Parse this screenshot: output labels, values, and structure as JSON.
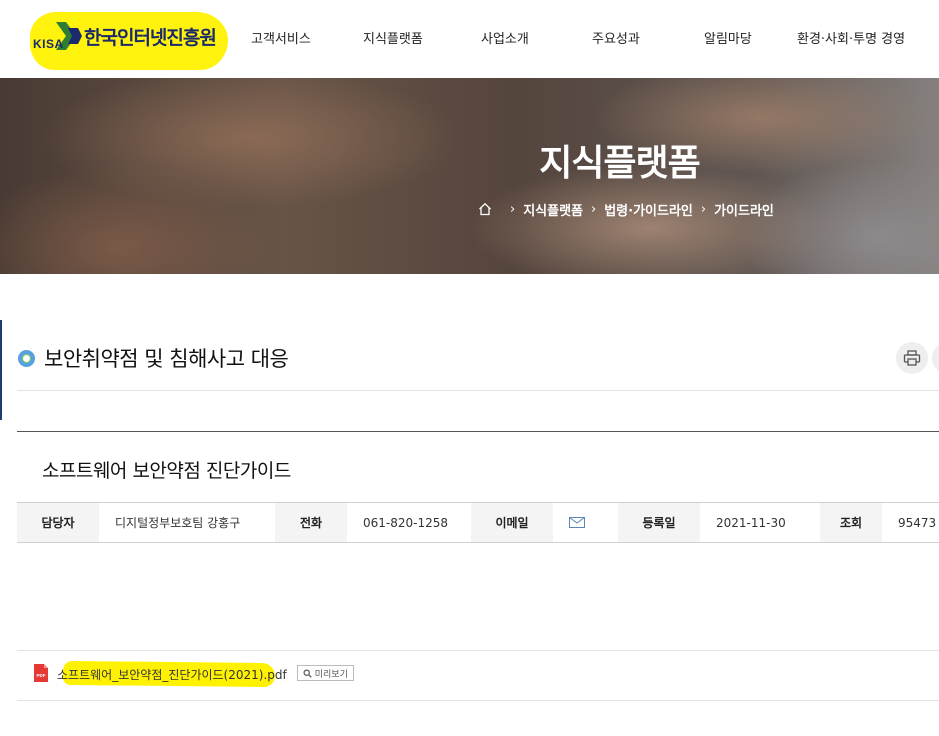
{
  "header": {
    "logo_abbr": "KISA",
    "logo_name": "한국인터넷진흥원",
    "nav": [
      "고객서비스",
      "지식플랫폼",
      "사업소개",
      "주요성과",
      "알림마당",
      "환경·사회·투명 경영"
    ]
  },
  "hero": {
    "title": "지식플랫폼",
    "breadcrumb": [
      "지식플랫폼",
      "법령·가이드라인",
      "가이드라인"
    ]
  },
  "section": {
    "title": "보안취약점 및 침해사고 대응"
  },
  "post": {
    "title": "소프트웨어 보안약점 진단가이드",
    "info": {
      "manager_label": "담당자",
      "manager_value": "디지털정부보호팀 강홍구",
      "phone_label": "전화",
      "phone_value": "061-820-1258",
      "email_label": "이메일",
      "date_label": "등록일",
      "date_value": "2021-11-30",
      "views_label": "조회",
      "views_value": "95473"
    },
    "attachment": {
      "file_name": "소프트웨어_보안약점_진단가이드(2021).pdf",
      "preview_label": "미리보기",
      "pdf_label": "PDF"
    }
  },
  "colors": {
    "brand_navy": "#1a2a6c",
    "highlight": "#fff200",
    "section_dot": "#56a1e0"
  }
}
